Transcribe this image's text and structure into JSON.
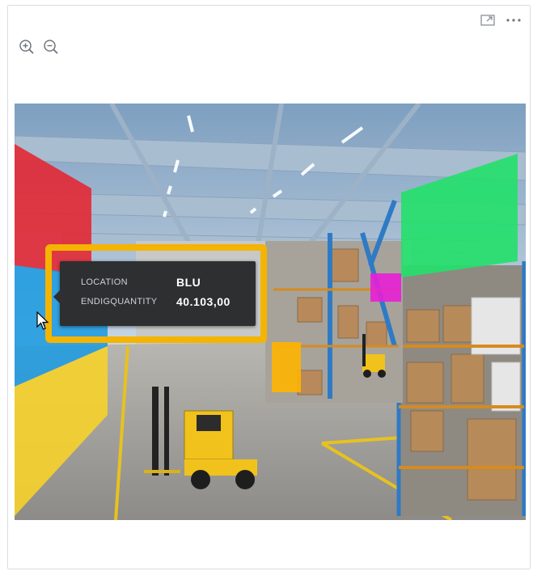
{
  "toolbar": {
    "icons": [
      "expand-icon",
      "more-options-icon"
    ]
  },
  "zoom": {
    "icons": [
      "zoom-in-icon",
      "zoom-out-icon"
    ]
  },
  "scene": {
    "highlight_zones": [
      {
        "name": "red",
        "color": "#e8202b"
      },
      {
        "name": "blue",
        "color": "#1e9be0"
      },
      {
        "name": "yellow",
        "color": "#f6d22b"
      },
      {
        "name": "orange",
        "color": "#ffb400"
      },
      {
        "name": "magenta",
        "color": "#e81fd6"
      },
      {
        "name": "green",
        "color": "#22e06a"
      }
    ]
  },
  "tooltip": {
    "rows": [
      {
        "key": "LOCATION",
        "value": "BLU"
      },
      {
        "key": "ENDIGQUANTITY",
        "value": "40.103,00"
      }
    ],
    "highlight_color": "#f4b400"
  }
}
